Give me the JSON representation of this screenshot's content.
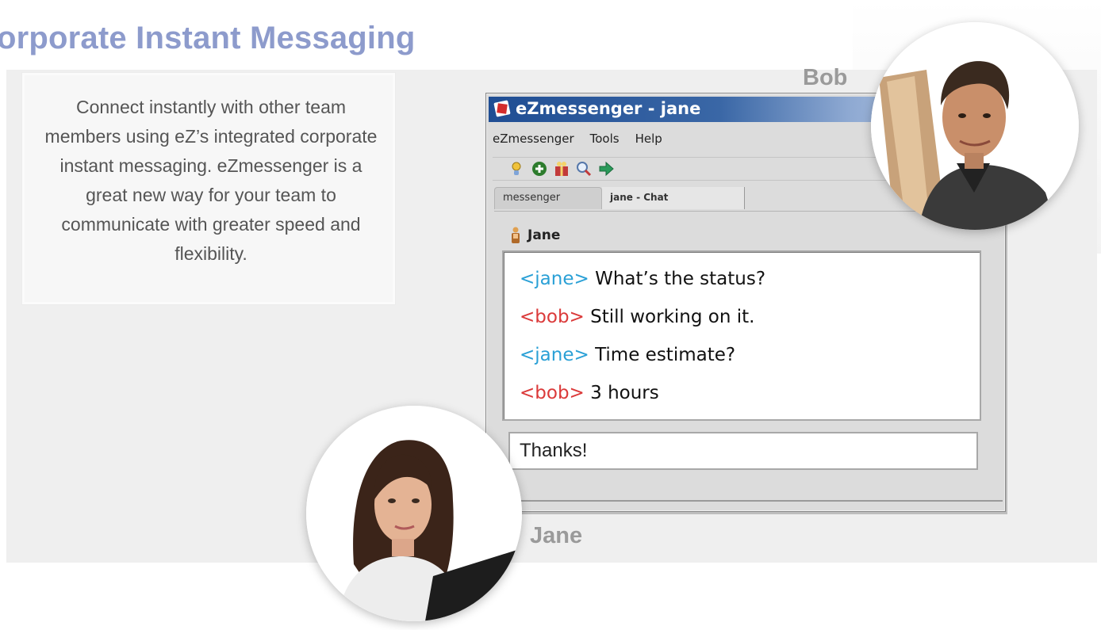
{
  "page": {
    "title": "orporate Instant Messaging",
    "intro": "Connect instantly with other team members using eZ’s integrated corporate instant messaging. eZmessenger is a great new way for your team to communicate with greater speed and flexibility."
  },
  "labels": {
    "bob": "Bob",
    "jane": "Jane"
  },
  "window": {
    "title": "eZmessenger - jane",
    "menu": [
      "eZmessenger",
      "Tools",
      "Help"
    ],
    "toolbar_icons": [
      "contacts-icon",
      "add-icon",
      "gift-icon",
      "search-icon",
      "forward-arrow-icon"
    ],
    "tabs": [
      "messenger",
      "jane - Chat"
    ],
    "chat_with": "Jane",
    "messages": [
      {
        "nick": "<jane>",
        "text": " What’s the status?",
        "color": "#2aa0d6"
      },
      {
        "nick": "<bob>",
        "text": " Still working on it.",
        "color": "#db3a3a"
      },
      {
        "nick": "<jane>",
        "text": " Time estimate?",
        "color": "#2aa0d6"
      },
      {
        "nick": "<bob>",
        "text": " 3 hours",
        "color": "#db3a3a"
      }
    ],
    "input_value": "Thanks!"
  },
  "colors": {
    "title": "#8d9bcc",
    "titlebar": "#1f4d93",
    "jane_nick": "#2aa0d6",
    "bob_nick": "#db3a3a"
  }
}
